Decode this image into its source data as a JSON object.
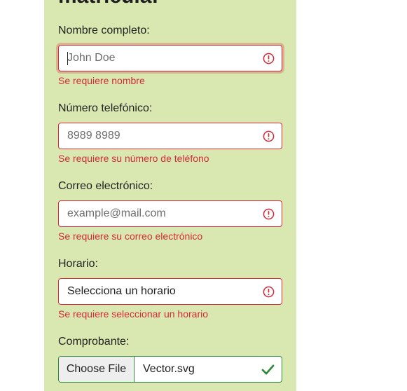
{
  "form": {
    "title": "matrícula:",
    "fields": {
      "name": {
        "label": "Nombre completo:",
        "placeholder": "John Doe",
        "value": "",
        "error": "Se requiere nombre"
      },
      "phone": {
        "label": "Número telefónico:",
        "placeholder": "8989 8989",
        "value": "",
        "error": "Se requiere su número de teléfono"
      },
      "email": {
        "label": "Correo electrónico:",
        "placeholder": "example@mail.com",
        "value": "",
        "error": "Se requiere su correo electrónico"
      },
      "schedule": {
        "label": "Horario:",
        "selected": "Selecciona un horario",
        "error": "Se requiere seleccionar un horario"
      },
      "receipt": {
        "label": "Comprobante:",
        "button_label": "Choose File",
        "file_name": "Vector.svg"
      }
    }
  },
  "colors": {
    "panel_background": "#d9e8b0",
    "error": "#d42a3a",
    "valid": "#2d8a3a"
  },
  "icons": {
    "invalid": "alert-circle-icon",
    "valid": "check-icon"
  }
}
